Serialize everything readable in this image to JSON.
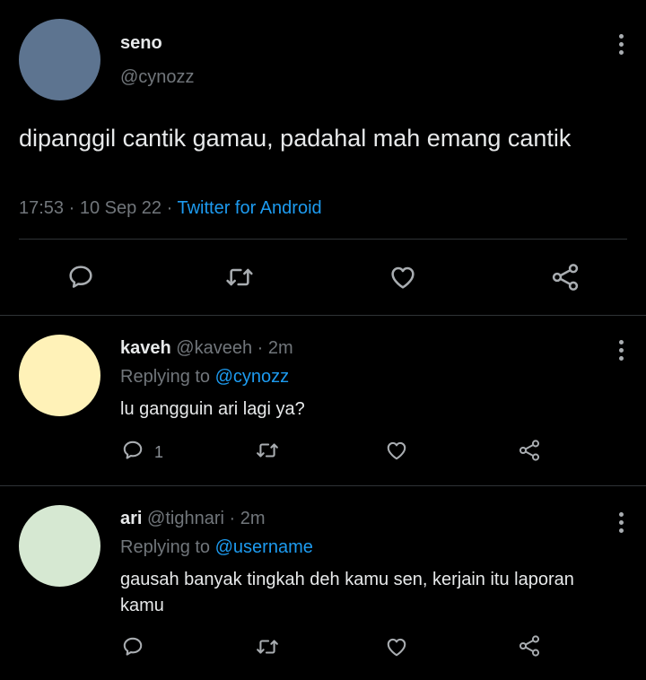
{
  "main_tweet": {
    "name": "seno",
    "handle": "@cynozz",
    "text": "dipanggil cantik gamau, padahal mah emang cantik",
    "time": "17:53",
    "date": "10 Sep 22",
    "source": "Twitter for Android",
    "avatar_color": "#5d7490"
  },
  "replies": [
    {
      "name": "kaveh",
      "handle": "@kaveeh",
      "time": "2m",
      "replying_label": "Replying to",
      "replying_to": "@cynozz",
      "text": "lu gangguin ari lagi ya?",
      "reply_count": "1",
      "avatar_color": "#fff2b8"
    },
    {
      "name": "ari",
      "handle": "@tighnari",
      "time": "2m",
      "replying_label": "Replying to",
      "replying_to": "@username",
      "text": "gausah banyak tingkah deh kamu sen, kerjain itu laporan kamu",
      "avatar_color": "#d6e8d2"
    }
  ],
  "colors": {
    "background": "#000000",
    "text": "#e7e9ea",
    "muted": "#71767b",
    "link": "#1d9bf0",
    "divider": "#2f3336"
  },
  "icons": [
    "reply-icon",
    "retweet-icon",
    "like-icon",
    "share-icon",
    "more-menu-icon"
  ]
}
